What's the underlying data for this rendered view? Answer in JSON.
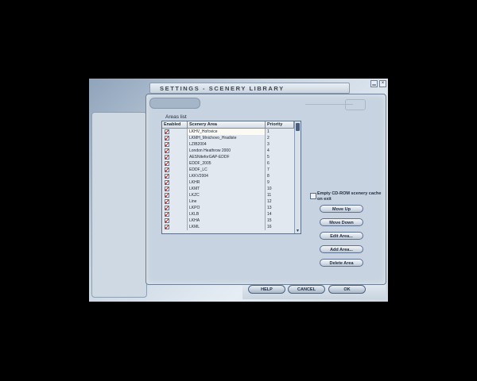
{
  "dialog": {
    "title": "SETTINGS - SCENERY LIBRARY",
    "areas_label": "Areas list",
    "columns": [
      "Enabled",
      "Scenery Area",
      "Priority"
    ],
    "rows": [
      {
        "area": "LKHV_Hořovice",
        "priority": "1",
        "enabled": true,
        "selected": true
      },
      {
        "area": "LKMH_Mnichovo_Hradiste",
        "priority": "2",
        "enabled": true
      },
      {
        "area": "LZIB2004",
        "priority": "3",
        "enabled": true
      },
      {
        "area": "London Heathrow 2000",
        "priority": "4",
        "enabled": true
      },
      {
        "area": "AESNiteforGAP-EDDF",
        "priority": "5",
        "enabled": true
      },
      {
        "area": "EDDF_2005",
        "priority": "6",
        "enabled": true
      },
      {
        "area": "EDDF_LC",
        "priority": "7",
        "enabled": true
      },
      {
        "area": "LKKV2004",
        "priority": "8",
        "enabled": true
      },
      {
        "area": "LKHR",
        "priority": "9",
        "enabled": true
      },
      {
        "area": "LKMT",
        "priority": "10",
        "enabled": true
      },
      {
        "area": "LKZC",
        "priority": "11",
        "enabled": true
      },
      {
        "area": "Line",
        "priority": "12",
        "enabled": true
      },
      {
        "area": "LKPO",
        "priority": "13",
        "enabled": true
      },
      {
        "area": "LKLB",
        "priority": "14",
        "enabled": true
      },
      {
        "area": "LKHA",
        "priority": "15",
        "enabled": true
      },
      {
        "area": "LKML",
        "priority": "16",
        "enabled": true
      }
    ],
    "buttons": {
      "move_up": "Move Up",
      "move_down": "Move Down",
      "edit_area": "Edit Area...",
      "add_area": "Add Area...",
      "delete_area": "Delete Area"
    },
    "cd_rom_label": "Empty CD-ROM scenery cache on exit"
  },
  "footer": {
    "help": "HELP",
    "cancel": "CANCEL",
    "ok": "OK"
  },
  "window_controls": {
    "minimize": "▁",
    "close": "×"
  },
  "icons": {
    "check": "✓",
    "scroll_down": "▼"
  }
}
